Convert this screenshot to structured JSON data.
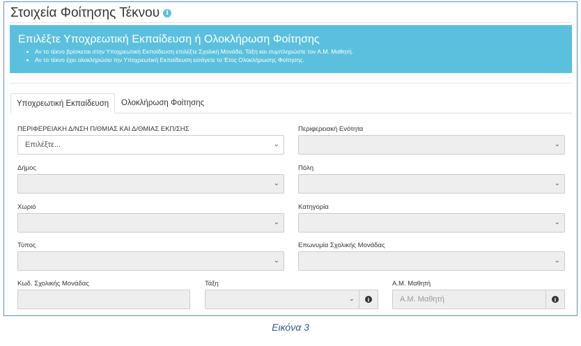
{
  "page": {
    "title": "Στοιχεία Φοίτησης Τέκνου",
    "info_glyph": "i",
    "info_icon": "info-circle-icon",
    "accent_color": "#5bc0de"
  },
  "alert": {
    "heading": "Επιλέξτε Υποχρεωτική Εκπαίδευση ή Ολοκλήρωση Φοίτησης",
    "items": [
      "Αν το τέκνο βρίσκεται στην Υποχρεωτική Εκπαίδευση επιλέξτε Σχολική Μονάδα, Τάξη και συμπληρώστε τον Α.Μ. Μαθητή.",
      "Αν το τέκνο έχει ολοκληρώσει την Υποχρεωτική Εκπαίδευση εισάγετε το Έτος Ολοκλήρωσης Φοίτησης."
    ]
  },
  "tabs": [
    {
      "label": "Υποχρεωτική Εκπαίδευση",
      "active": true
    },
    {
      "label": "Ολοκλήρωση Φοίτησης",
      "active": false
    }
  ],
  "form": {
    "region_label": "ΠΕΡΙΦΕΡΕΙΑΚΗ Δ/ΝΣΗ Π/ΘΜΙΑΣ ΚΑΙ Δ/ΘΜΙΑΣ ΕΚΠ/ΣΗΣ",
    "region_value": "Επιλέξτε...",
    "unit_label": "Περιφερειακή Ενότητα",
    "unit_value": "",
    "municipality_label": "Δήμος",
    "municipality_value": "",
    "city_label": "Πόλη",
    "city_value": "",
    "village_label": "Χωριό",
    "village_value": "",
    "category_label": "Κατηγορία",
    "category_value": "",
    "type_label": "Τύπος",
    "type_value": "",
    "school_name_label": "Επωνυμία Σχολικής Μονάδας",
    "school_name_value": "",
    "school_code_label": "Κωδ. Σχολικής Μονάδας",
    "school_code_value": "",
    "class_label": "Τάξη",
    "class_value": "",
    "student_id_label": "Α.Μ. Μαθητή",
    "student_id_placeholder": "Α.Μ. Μαθητή",
    "chevron_icon": "chevron-down-icon",
    "chevron_glyph": "⌄"
  },
  "caption": "Εικόνα 3"
}
